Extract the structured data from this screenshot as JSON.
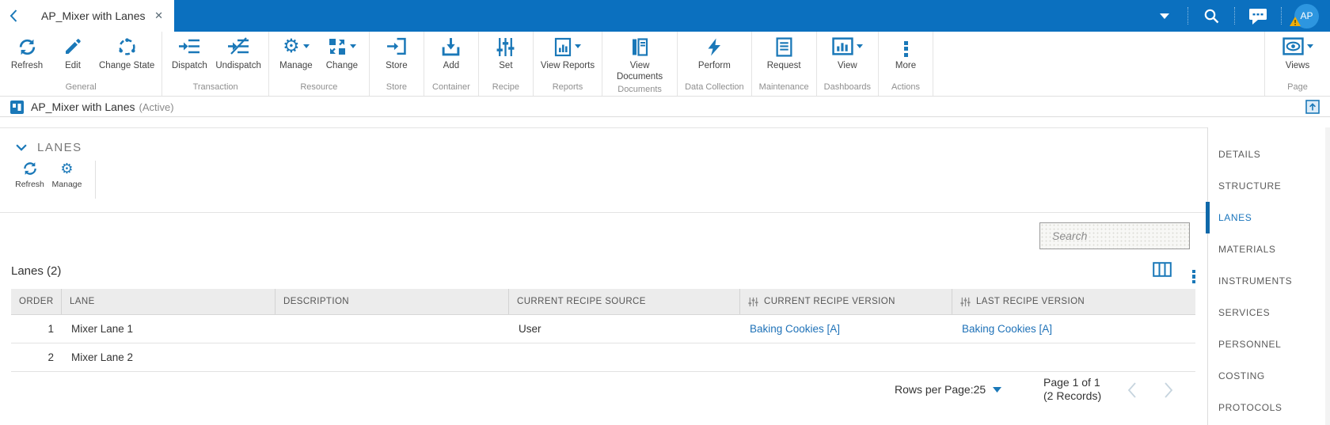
{
  "topbar": {
    "tab_title": "AP_Mixer with Lanes",
    "close_glyph": "✕",
    "avatar_initials": "AP",
    "icons": [
      "back-chevron",
      "dropdown-caret",
      "search",
      "chat",
      "avatar-warning"
    ]
  },
  "ribbon": {
    "groups": [
      {
        "label": "General",
        "buttons": [
          {
            "label": "Refresh",
            "icon": "refresh-arrows"
          },
          {
            "label": "Edit",
            "icon": "pencil"
          },
          {
            "label": "Change State",
            "icon": "state-cycle"
          }
        ]
      },
      {
        "label": "Transaction",
        "buttons": [
          {
            "label": "Dispatch",
            "icon": "arrow-to-list"
          },
          {
            "label": "Undispatch",
            "icon": "arrow-to-list-slash"
          }
        ]
      },
      {
        "label": "Resource",
        "buttons": [
          {
            "label": "Manage",
            "icon": "gear",
            "caret": true
          },
          {
            "label": "Change",
            "icon": "swap-squares",
            "caret": true
          }
        ]
      },
      {
        "label": "Store",
        "buttons": [
          {
            "label": "Store",
            "icon": "arrow-into-bracket"
          }
        ]
      },
      {
        "label": "Container",
        "buttons": [
          {
            "label": "Add",
            "icon": "tray-download"
          }
        ]
      },
      {
        "label": "Recipe",
        "buttons": [
          {
            "label": "Set",
            "icon": "sliders"
          }
        ]
      },
      {
        "label": "Reports",
        "buttons": [
          {
            "label": "View Reports",
            "icon": "document-chart",
            "caret": true
          }
        ]
      },
      {
        "label": "Documents",
        "buttons": [
          {
            "label": "View Documents",
            "icon": "book"
          }
        ]
      },
      {
        "label": "Data Collection",
        "buttons": [
          {
            "label": "Perform",
            "icon": "lightning-bolt"
          }
        ]
      },
      {
        "label": "Maintenance",
        "buttons": [
          {
            "label": "Request",
            "icon": "document-lines"
          }
        ]
      },
      {
        "label": "Dashboards",
        "buttons": [
          {
            "label": "View",
            "icon": "chart-box",
            "caret": true
          }
        ]
      },
      {
        "label": "Actions",
        "buttons": [
          {
            "label": "More",
            "icon": "kebab-dots"
          }
        ]
      },
      {
        "label": "Page",
        "buttons": [
          {
            "label": "Views",
            "icon": "eye-box",
            "caret": true
          }
        ]
      }
    ]
  },
  "titlebar": {
    "title": "AP_Mixer with Lanes",
    "status": "(Active)"
  },
  "section": {
    "title": "LANES",
    "toolbar": [
      {
        "label": "Refresh",
        "icon": "refresh-arrows"
      },
      {
        "label": "Manage",
        "icon": "gear"
      }
    ]
  },
  "search": {
    "placeholder": "Search"
  },
  "table": {
    "title": "Lanes (2)",
    "columns": [
      "ORDER",
      "LANE",
      "DESCRIPTION",
      "CURRENT RECIPE SOURCE",
      "CURRENT RECIPE VERSION",
      "LAST RECIPE VERSION"
    ],
    "filter_icon_columns": [
      "CURRENT RECIPE VERSION",
      "LAST RECIPE VERSION"
    ],
    "rows": [
      {
        "order": "1",
        "lane": "Mixer Lane 1",
        "description": "",
        "source": "User",
        "current": "Baking Cookies [A]",
        "last": "Baking Cookies [A]"
      },
      {
        "order": "2",
        "lane": "Mixer Lane 2",
        "description": "",
        "source": "",
        "current": "",
        "last": ""
      }
    ]
  },
  "pagination": {
    "rows_per_page_label": "Rows per Page:",
    "rows_per_page_value": "25",
    "page_info": "Page 1 of 1",
    "records": "(2 Records)"
  },
  "sidebar": {
    "items": [
      {
        "label": "DETAILS"
      },
      {
        "label": "STRUCTURE"
      },
      {
        "label": "LANES",
        "selected": true
      },
      {
        "label": "MATERIALS"
      },
      {
        "label": "INSTRUMENTS"
      },
      {
        "label": "SERVICES"
      },
      {
        "label": "PERSONNEL"
      },
      {
        "label": "COSTING"
      },
      {
        "label": "PROTOCOLS"
      }
    ]
  },
  "colors": {
    "topbar_blue": "#0b70bf",
    "icon_blue": "#1a78b8",
    "link_blue": "#1f72b8",
    "selected_blue": "#0f68a9",
    "warning_yellow": "#f0ad0a",
    "header_gray": "#ececec"
  }
}
